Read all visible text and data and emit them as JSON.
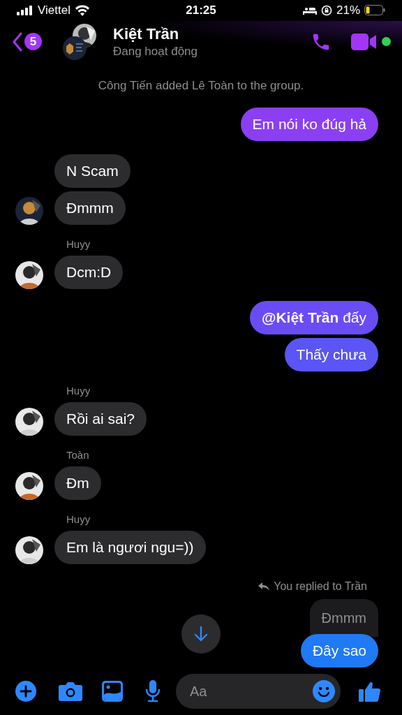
{
  "status_bar": {
    "carrier": "Viettel",
    "time": "21:25",
    "battery": "21%"
  },
  "header": {
    "unread_count": "5",
    "name": "Kiệt Trần",
    "status": "Đang hoạt động",
    "online": true
  },
  "messages": [
    {
      "kind": "system",
      "text": "Công Tiến added Lê Toàn to the group."
    },
    {
      "kind": "out",
      "text": "Em nói ko đúg hả",
      "color": "#8b3ff3"
    },
    {
      "kind": "in",
      "text": "N Scam",
      "avatar": false
    },
    {
      "kind": "in",
      "text": "Đmmm",
      "avatar": true
    },
    {
      "kind": "label",
      "text": "Huyy"
    },
    {
      "kind": "in",
      "text": "Dcm:D",
      "avatar": true
    },
    {
      "kind": "out",
      "text": "**@Kiệt Trần** đấy",
      "color": "#6a4cf5"
    },
    {
      "kind": "out",
      "text": "Thấy chưa",
      "color": "#5a55f4"
    },
    {
      "kind": "label",
      "text": "Huyy"
    },
    {
      "kind": "in",
      "text": "Rồi ai sai?",
      "avatar": true
    },
    {
      "kind": "label",
      "text": "Toàn"
    },
    {
      "kind": "in",
      "text": "Đm",
      "avatar": true
    },
    {
      "kind": "label",
      "text": "Huyy"
    },
    {
      "kind": "in",
      "text": "Em là ngươi ngu=))",
      "avatar": true
    },
    {
      "kind": "reply_note",
      "text": "You replied to Trần"
    },
    {
      "kind": "quote",
      "text": "Đmmm"
    },
    {
      "kind": "out",
      "text": "Đây sao",
      "color": "#2079f5"
    }
  ],
  "composer": {
    "placeholder": "Aa"
  }
}
